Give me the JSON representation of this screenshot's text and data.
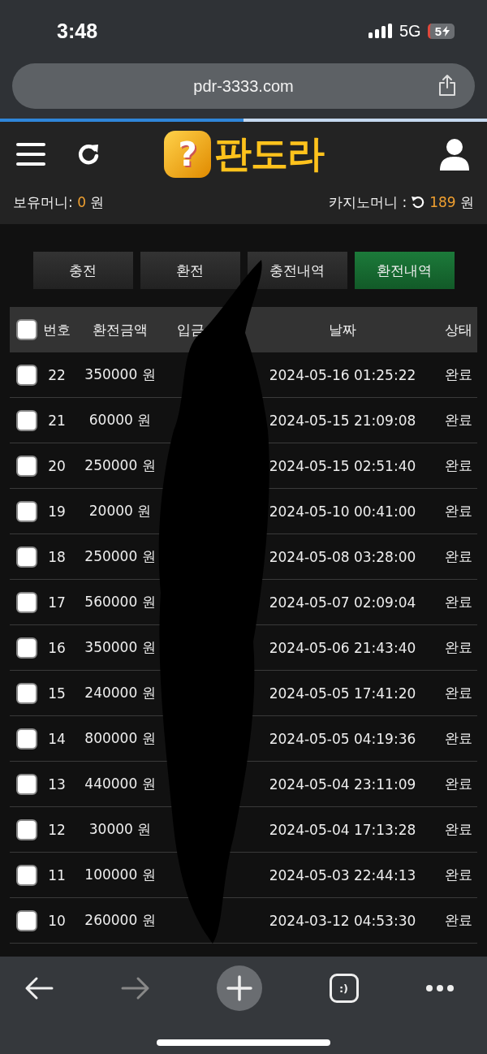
{
  "status_bar": {
    "time": "3:48",
    "network": "5G",
    "battery": "5"
  },
  "browser": {
    "url": "pdr-3333.com",
    "progress": {
      "level": 0.5
    }
  },
  "header": {
    "logo_mark": "?",
    "logo_text": "판도라"
  },
  "balance": {
    "label": "보유머니:",
    "amount": "0",
    "unit": "원",
    "casino_label": "카지노머니 :",
    "casino_amount": "189",
    "casino_unit": "원"
  },
  "tabs": [
    {
      "label": "충전",
      "selected": false
    },
    {
      "label": "환전",
      "selected": false
    },
    {
      "label": "충전내역",
      "selected": false
    },
    {
      "label": "환전내역",
      "selected": true
    }
  ],
  "table": {
    "all_checked": false,
    "columns": [
      "번호",
      "환전금액",
      "입금",
      "날짜",
      "상태"
    ],
    "rows": [
      {
        "checked": false,
        "no": "22",
        "amount": "350000 원",
        "date": "2024-05-16 01:25:22",
        "status": "완료"
      },
      {
        "checked": false,
        "no": "21",
        "amount": "60000 원",
        "date": "2024-05-15 21:09:08",
        "status": "완료"
      },
      {
        "checked": false,
        "no": "20",
        "amount": "250000 원",
        "date": "2024-05-15 02:51:40",
        "status": "완료"
      },
      {
        "checked": false,
        "no": "19",
        "amount": "20000 원",
        "date": "2024-05-10 00:41:00",
        "status": "완료"
      },
      {
        "checked": false,
        "no": "18",
        "amount": "250000 원",
        "date": "2024-05-08 03:28:00",
        "status": "완료"
      },
      {
        "checked": false,
        "no": "17",
        "amount": "560000 원",
        "date": "2024-05-07 02:09:04",
        "status": "완료"
      },
      {
        "checked": false,
        "no": "16",
        "amount": "350000 원",
        "date": "2024-05-06 21:43:40",
        "status": "완료"
      },
      {
        "checked": false,
        "no": "15",
        "amount": "240000 원",
        "date": "2024-05-05 17:41:20",
        "status": "완료"
      },
      {
        "checked": false,
        "no": "14",
        "amount": "800000 원",
        "date": "2024-05-05 04:19:36",
        "status": "완료"
      },
      {
        "checked": false,
        "no": "13",
        "amount": "440000 원",
        "date": "2024-05-04 23:11:09",
        "status": "완료"
      },
      {
        "checked": false,
        "no": "12",
        "amount": "30000 원",
        "date": "2024-05-04 17:13:28",
        "status": "완료"
      },
      {
        "checked": false,
        "no": "11",
        "amount": "100000 원",
        "date": "2024-05-03 22:44:13",
        "status": "완료"
      },
      {
        "checked": false,
        "no": "10",
        "amount": "260000 원",
        "date": "2024-03-12 04:53:30",
        "status": "완료"
      }
    ]
  },
  "toolbar": {
    "tabs_label": ":)"
  }
}
